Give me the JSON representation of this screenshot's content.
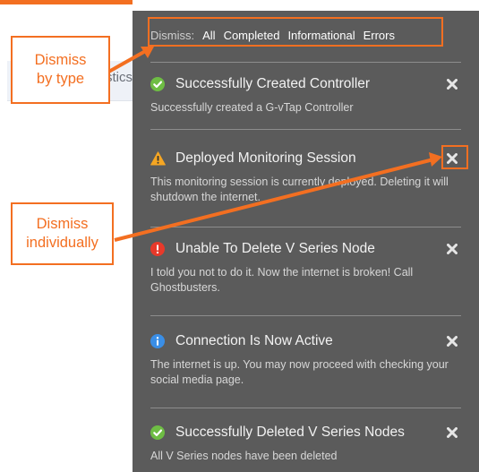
{
  "background": {
    "partial_tab_text": "stics"
  },
  "panel": {
    "dismiss": {
      "label": "Dismiss:",
      "options": [
        "All",
        "Completed",
        "Informational",
        "Errors"
      ]
    },
    "notifications": [
      {
        "icon": "check-circle-icon",
        "color": "#6ebd44",
        "title": "Successfully Created Controller",
        "message": "Successfully created a G-vTap Controller"
      },
      {
        "icon": "warning-triangle-icon",
        "color": "#f5a623",
        "title": "Deployed Monitoring Session",
        "message": "This monitoring session is currently deployed. Deleting it will shutdown the internet."
      },
      {
        "icon": "error-circle-icon",
        "color": "#e8392a",
        "title": "Unable To Delete V Series Node",
        "message": "I told you not to do it. Now the internet is broken! Call Ghostbusters."
      },
      {
        "icon": "info-circle-icon",
        "color": "#3a8ee6",
        "title": "Connection Is Now Active",
        "message": "The internet is up. You may now proceed with checking your social media page."
      },
      {
        "icon": "check-circle-icon",
        "color": "#6ebd44",
        "title": "Successfully Deleted V Series Nodes",
        "message": "All V Series nodes have been deleted"
      }
    ]
  },
  "annotations": {
    "by_type": "Dismiss by type",
    "individually": "Dismiss individually",
    "color": "#f36f21"
  }
}
